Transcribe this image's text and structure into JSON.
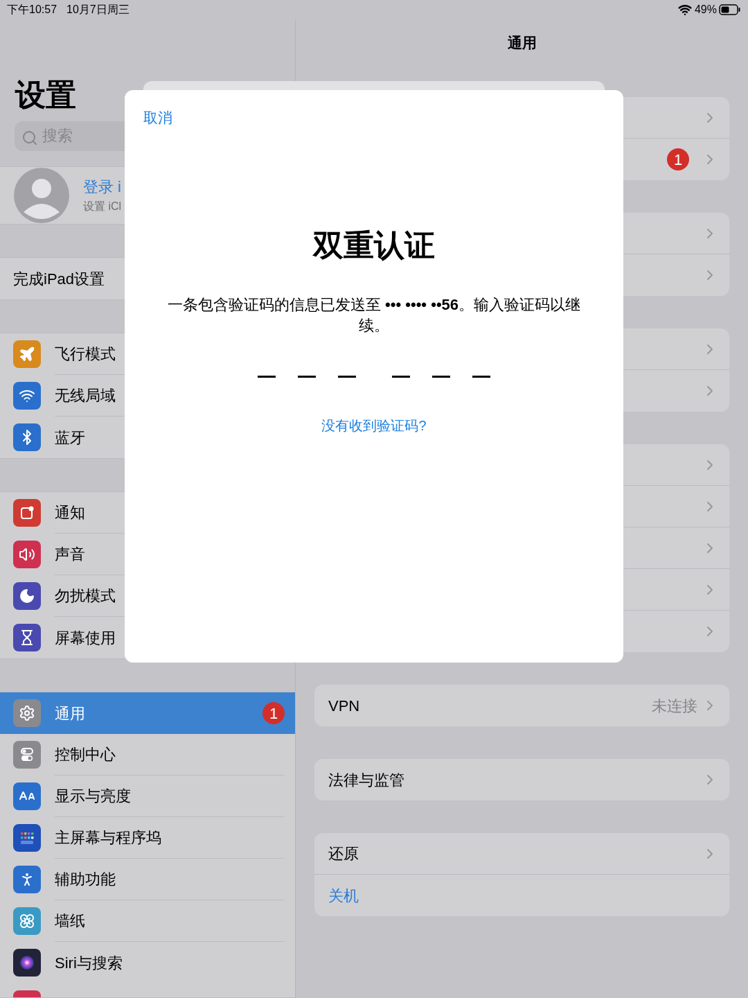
{
  "status_bar": {
    "time": "下午10:57",
    "date": "10月7日周三",
    "battery": "49%"
  },
  "sidebar": {
    "title": "设置",
    "search": {
      "placeholder": "搜索"
    },
    "account": {
      "title": "登录 i",
      "subtitle": "设置 iCl"
    },
    "sections": [
      {
        "kind": "plain",
        "items": [
          {
            "label": "完成iPad设置",
            "selected": false
          }
        ]
      },
      {
        "kind": "icons",
        "items": [
          {
            "label": "飞行模式",
            "selected": false
          },
          {
            "label": "无线局域",
            "selected": false
          },
          {
            "label": "蓝牙",
            "selected": false
          }
        ]
      },
      {
        "kind": "icons",
        "items": [
          {
            "label": "通知",
            "selected": false
          },
          {
            "label": "声音",
            "selected": false
          },
          {
            "label": "勿扰模式",
            "selected": false
          },
          {
            "label": "屏幕使用",
            "selected": false
          }
        ]
      },
      {
        "kind": "icons",
        "items": [
          {
            "label": "通用",
            "selected": true,
            "badge": "1"
          },
          {
            "label": "控制中心",
            "selected": false
          },
          {
            "label": "显示与亮度",
            "selected": false
          },
          {
            "label": "主屏幕与程序坞",
            "selected": false
          },
          {
            "label": "辅助功能",
            "selected": false
          },
          {
            "label": "墙纸",
            "selected": false
          },
          {
            "label": "Siri与搜索",
            "selected": false
          }
        ]
      }
    ]
  },
  "detail": {
    "title": "通用",
    "groups": [
      {
        "rows": [
          {
            "kind": "link"
          },
          {
            "kind": "link",
            "badge": "1"
          }
        ]
      },
      {
        "rows": [
          {
            "kind": "link"
          },
          {
            "kind": "link"
          }
        ]
      },
      {
        "rows": [
          {
            "kind": "link"
          },
          {
            "kind": "link"
          }
        ]
      },
      {
        "rows": [
          {
            "kind": "link"
          },
          {
            "kind": "link"
          },
          {
            "kind": "link"
          },
          {
            "kind": "link"
          },
          {
            "kind": "link"
          }
        ]
      },
      {
        "rows": [
          {
            "kind": "link",
            "label": "VPN",
            "value": "未连接"
          }
        ]
      },
      {
        "rows": [
          {
            "kind": "link",
            "label": "法律与监管"
          }
        ]
      },
      {
        "rows": [
          {
            "kind": "link",
            "label": "还原"
          },
          {
            "kind": "action",
            "label": "关机"
          }
        ]
      }
    ]
  },
  "dialog": {
    "cancel": "取消",
    "title": "双重认证",
    "message": "一条包含验证码的信息已发送至 **••• •••• ••56**。输入验证码以继续。",
    "code_slots": [
      {
        "filled": false
      },
      {
        "filled": false
      },
      {
        "filled": false
      },
      {
        "filled": false
      },
      {
        "filled": false
      },
      {
        "filled": false
      }
    ],
    "help_link": "没有收到验证码?"
  }
}
